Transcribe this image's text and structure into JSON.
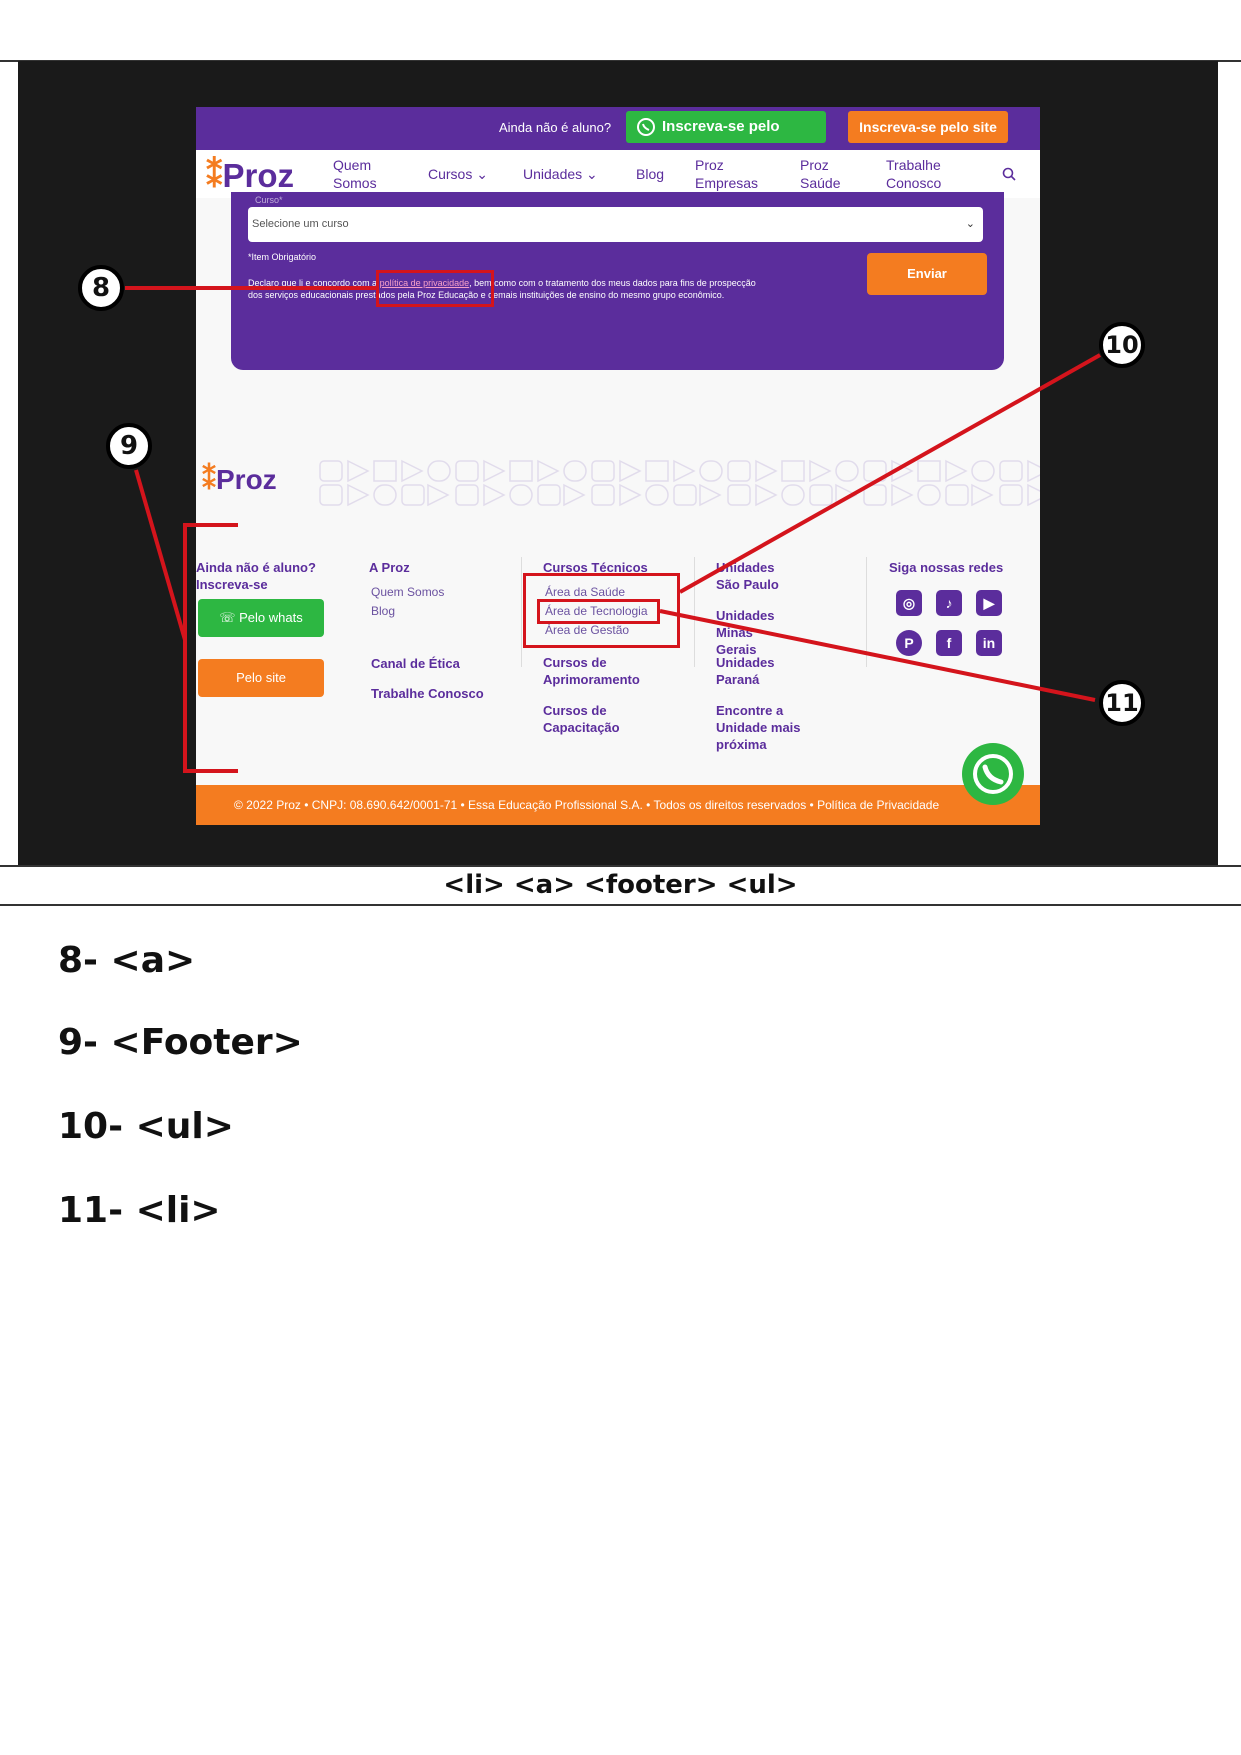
{
  "site": {
    "topbar": {
      "not_student": "Ainda não é aluno?",
      "whats_btn": "Inscreva-se pelo Whats",
      "site_btn": "Inscreva-se pelo site"
    },
    "logo": "Proz",
    "nav": [
      "Quem Somos",
      "Cursos",
      "Unidades",
      "Blog",
      "Proz Empresas",
      "Proz Saúde",
      "Trabalhe Conosco"
    ],
    "form": {
      "field_label": "Curso*",
      "select_placeholder": "Selecione um curso",
      "required_note": "*Item Obrigatório",
      "consent_prefix": "Declaro que li e concordo com a",
      "privacy_link": "política de privacidade",
      "consent_line1": ", bem como com o tratamento dos meus dados para fins de prospecção",
      "consent_line2": "dos serviços educacionais prestados pela Proz Educação e demais instituições de ensino do mesmo grupo econômico.",
      "submit": "Enviar"
    },
    "footer": {
      "logo": "Proz",
      "col1": {
        "heading": "Ainda não é aluno? Inscreva-se",
        "whats_btn": "Pelo whats",
        "site_btn": "Pelo site"
      },
      "col2": {
        "heading": "A Proz",
        "links": [
          "Quem Somos",
          "Blog"
        ],
        "extra": [
          "Canal de Ética",
          "Trabalhe Conosco"
        ]
      },
      "col3": {
        "heading": "Cursos Técnicos",
        "links": [
          "Área da Saúde",
          "Área de Tecnologia",
          "Área de Gestão"
        ],
        "extra": [
          "Cursos de Aprimoramento",
          "Cursos de Capacitação"
        ]
      },
      "col4": {
        "items": [
          "Unidades São Paulo",
          "Unidades Minas Gerais",
          "Unidades Paraná",
          "Encontre a Unidade mais próxima"
        ]
      },
      "col5": {
        "heading": "Siga nossas redes",
        "icons": [
          "instagram-icon",
          "tiktok-icon",
          "youtube-icon",
          "pinterest-icon",
          "facebook-icon",
          "linkedin-icon"
        ]
      },
      "bottom": "© 2022 Proz • CNPJ: 08.690.642/0001-71 • Essa Educação Profissional S.A. • Todos os direitos reservados • Política de Privacidade"
    }
  },
  "annotations": {
    "n8": "8",
    "n9": "9",
    "n10": "10",
    "n11": "11"
  },
  "caption": "<li> <a> <footer> <ul>",
  "legend": [
    "8- <a>",
    "9- <Footer>",
    "10- <ul>",
    "11- <li>"
  ],
  "colors": {
    "purple": "#5b2d9c",
    "orange": "#f47c20",
    "green": "#2db742",
    "red": "#d4141c"
  }
}
